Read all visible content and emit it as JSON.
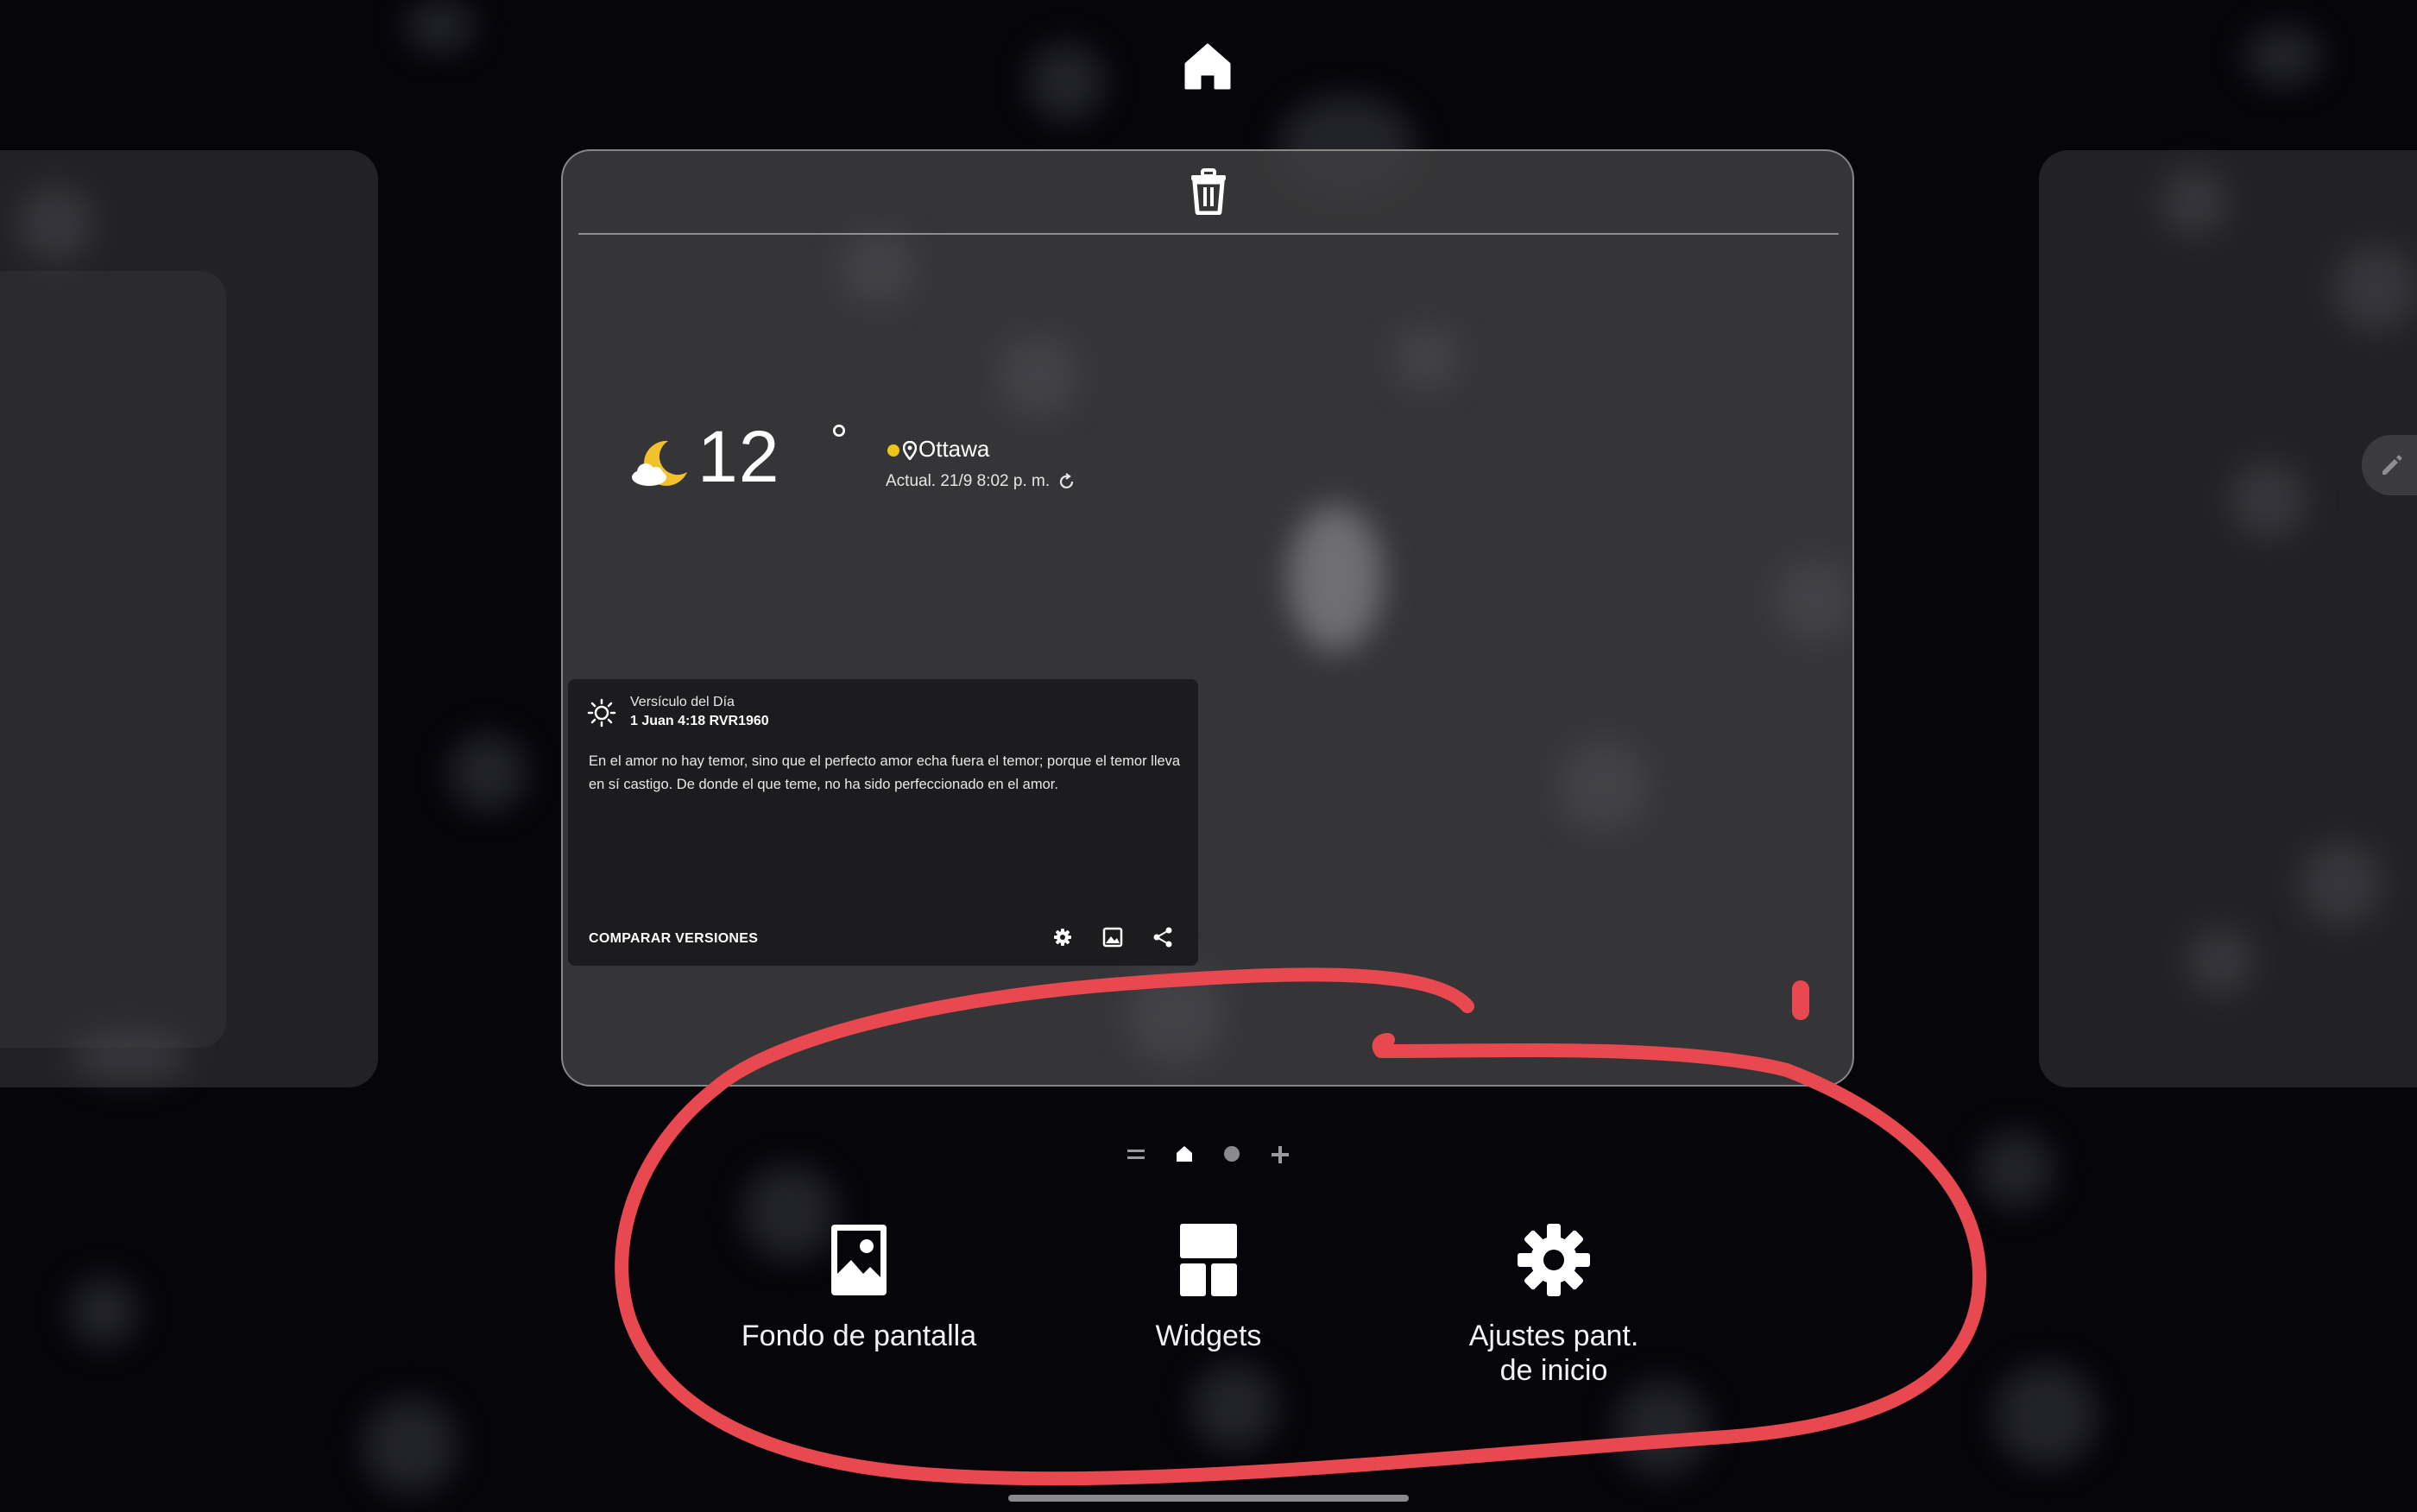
{
  "weather": {
    "temperature": "12",
    "degree_symbol": "°",
    "city": "Ottawa",
    "updated": "Actual. 21/9 8:02 p. m.",
    "icon": "moon-cloud-icon"
  },
  "verse_widget": {
    "heading": "Versículo del Día",
    "reference": "1 Juan 4:18 RVR1960",
    "text": "En el amor no hay temor, sino que el perfecto amor echa fuera el temor; porque el temor lleva en sí castigo. De donde el que teme, no ha sido perfeccionado en el amor.",
    "compare_label": "COMPARAR VERSIONES",
    "tools": [
      "gear-icon",
      "image-icon",
      "share-icon"
    ]
  },
  "page_indicator": {
    "items": [
      "menu-lines-icon",
      "home-icon",
      "dot-icon",
      "plus-icon"
    ],
    "selected": "home-icon"
  },
  "options": {
    "wallpaper": "Fondo de pantalla",
    "widgets": "Widgets",
    "settings_line1": "Ajustes pant.",
    "settings_line2": "de inicio"
  },
  "colors": {
    "background": "#05050a",
    "annotation": "#e8484f",
    "weather_dot": "#f0c419",
    "moon": "#f2c12e"
  }
}
